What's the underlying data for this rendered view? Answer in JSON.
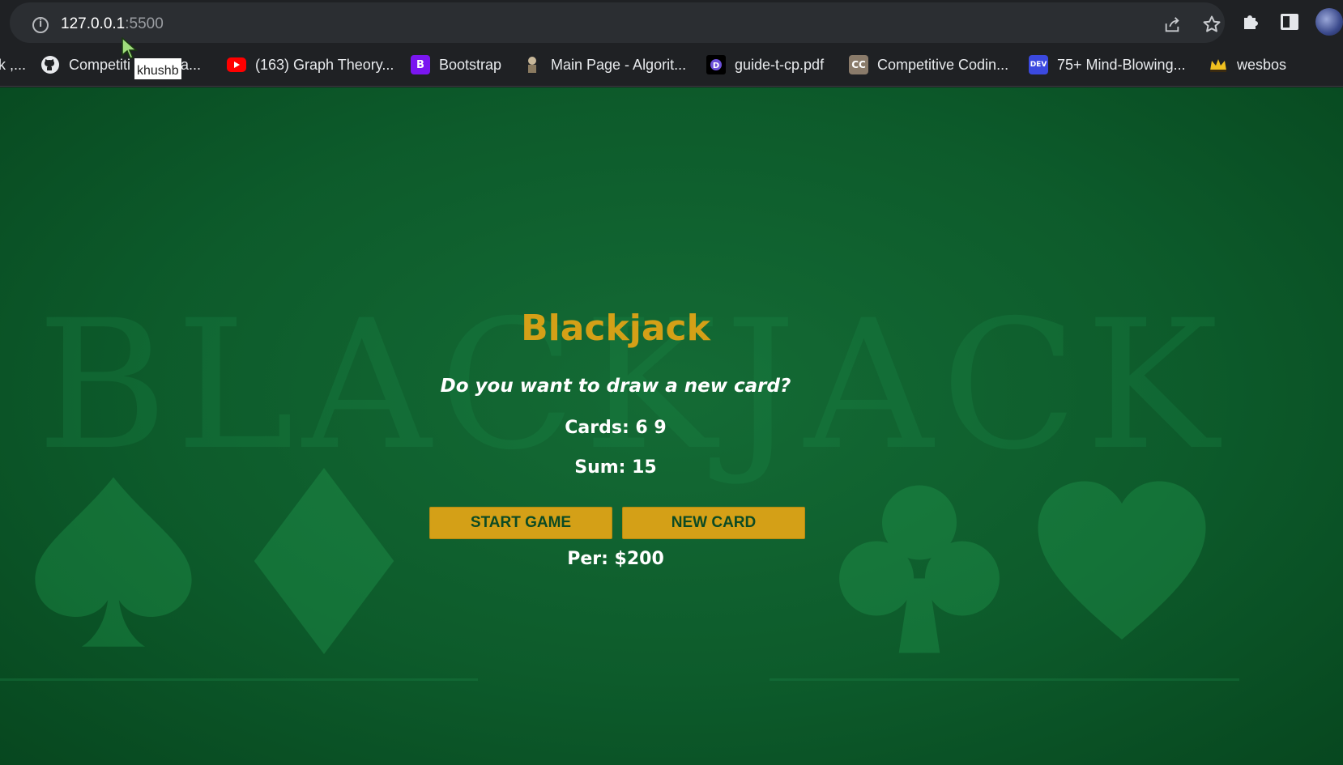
{
  "browser": {
    "url_host": "127.0.0.1",
    "url_port": ":5500",
    "tooltip": "khushb",
    "bookmarks": [
      {
        "label": "k ,...",
        "icon": "generic-icon"
      },
      {
        "label": "Competiti",
        "trailing": "a...",
        "icon": "github-icon"
      },
      {
        "label": "(163) Graph Theory...",
        "icon": "youtube-icon"
      },
      {
        "label": "Bootstrap",
        "icon": "bootstrap-icon"
      },
      {
        "label": "Main Page - Algorit...",
        "icon": "algorithmica-icon"
      },
      {
        "label": "guide-t-cp.pdf",
        "icon": "pdf-icon"
      },
      {
        "label": "Competitive Codin...",
        "icon": "cc-icon"
      },
      {
        "label": "75+ Mind-Blowing...",
        "icon": "dev-icon"
      },
      {
        "label": "wesbos",
        "icon": "crown-icon"
      }
    ]
  },
  "page": {
    "background_word": "BLACKJACK"
  },
  "game": {
    "title": "Blackjack",
    "message": "Do you want to draw a new card?",
    "cards_label": "Cards: 6 9",
    "sum_label": "Sum: 15",
    "start_button": "START GAME",
    "new_card_button": "NEW CARD",
    "player_label": "Per: $200"
  },
  "colors": {
    "accent": "#d4a017",
    "table_green": "#0d5b2b",
    "chrome": "#1f2124"
  }
}
